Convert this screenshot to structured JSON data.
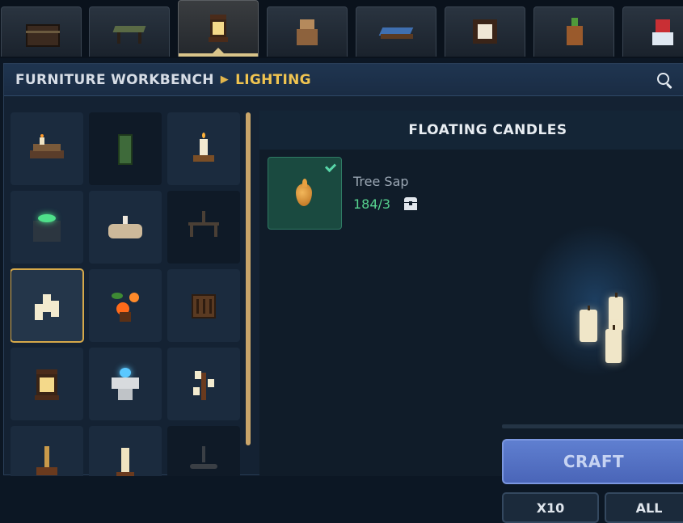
{
  "tabs": [
    {
      "icon": "chest-icon"
    },
    {
      "icon": "table-icon"
    },
    {
      "icon": "lantern-icon",
      "active": true
    },
    {
      "icon": "pottery-icon"
    },
    {
      "icon": "bed-icon"
    },
    {
      "icon": "window-block-icon"
    },
    {
      "icon": "sprout-pot-icon"
    },
    {
      "icon": "snow-gift-icon"
    }
  ],
  "header": {
    "root": "FURNITURE WORKBENCH",
    "current": "LIGHTING",
    "search_icon": "search-icon"
  },
  "grid_items": [
    {
      "icon": "candle-books-icon"
    },
    {
      "icon": "green-cabinet-icon",
      "dim": true
    },
    {
      "icon": "candle-holder-icon"
    },
    {
      "icon": "green-brazier-icon"
    },
    {
      "icon": "bone-candles-icon"
    },
    {
      "icon": "iron-chandelier-icon",
      "dim": true
    },
    {
      "icon": "floating-candles-icon",
      "selected": true
    },
    {
      "icon": "flower-lamp-icon"
    },
    {
      "icon": "wooden-crate-lamp-icon"
    },
    {
      "icon": "lantern-icon"
    },
    {
      "icon": "ice-brazier-icon"
    },
    {
      "icon": "candle-stand-icon"
    },
    {
      "icon": "hanging-lamp-icon"
    },
    {
      "icon": "tall-candle-icon"
    },
    {
      "icon": "dark-chandelier-icon",
      "dim": true
    }
  ],
  "detail": {
    "title": "FLOATING CANDLES",
    "ingredient": {
      "name": "Tree Sap",
      "count": "184/3",
      "icon": "tree-sap-icon",
      "status_icon": "check-icon",
      "storage_icon": "chest-icon"
    },
    "preview_icon": "floating-candles-icon"
  },
  "actions": {
    "craft": "CRAFT",
    "x10": "X10",
    "all": "ALL"
  },
  "colors": {
    "accent_gold": "#f0c450",
    "success_green": "#57d38f",
    "craft_blue": "#5f7fd0"
  }
}
